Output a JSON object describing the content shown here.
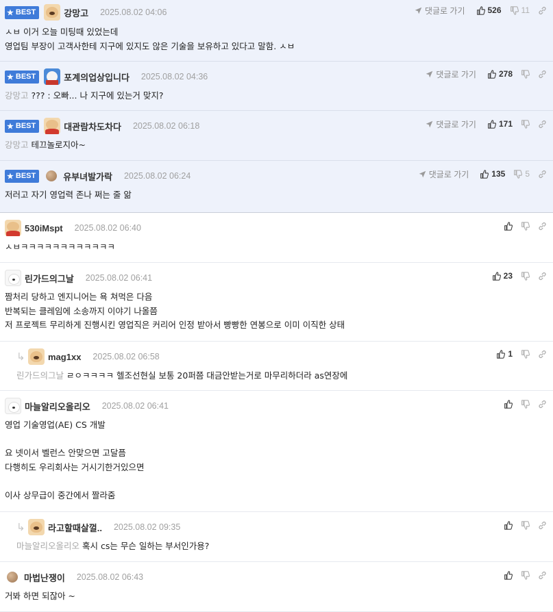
{
  "best_label": "BEST",
  "reply_to_label": "댓글로 가기",
  "comments": [
    {
      "username": "강망고",
      "date": "2025.08.02 04:06",
      "up": "526",
      "down": "11",
      "lines": [
        "ㅅㅂ 이거 오늘 미팅때 있었는데",
        "영업팀 부장이 고객사한테 지구에 있지도 않은 기술을 보유하고 있다고 말함. ㅅㅂ"
      ]
    },
    {
      "username": "포계의업상입니다",
      "date": "2025.08.02 04:36",
      "up": "278",
      "down": "",
      "mention": "강망고",
      "text": "??? : 오빠... 나 지구에 있는거 맞지?"
    },
    {
      "username": "대관람차도차다",
      "date": "2025.08.02 06:18",
      "up": "171",
      "down": "",
      "mention": "강망고",
      "text": "테끄놀로지아~"
    },
    {
      "username": "유부녀발가락",
      "date": "2025.08.02 06:24",
      "up": "135",
      "down": "5",
      "text": "저러고 자기 영업력 존나 쩌는 줄 앎"
    },
    {
      "username": "530iMspt",
      "date": "2025.08.02 06:40",
      "up": "",
      "text": "ㅅㅂㅋㅋㅋㅋㅋㅋㅋㅋㅋㅋㅋㅋ"
    },
    {
      "username": "린가드의그날",
      "date": "2025.08.02 06:41",
      "up": "23",
      "lines": [
        "짬처리 당하고 엔지니어는 욕 쳐먹은 다음",
        "반복되는 클레임에 소송까지 이야기 나올쯤",
        "저 프로젝트 무리하게 진행시킨 영업직은 커리어 인정 받아서 빵빵한 연봉으로 이미 이직한 상태"
      ]
    },
    {
      "username": "mag1xx",
      "date": "2025.08.02 06:58",
      "up": "1",
      "mention": "린가드의그날",
      "text": "ㄹㅇㅋㅋㅋㅋ 헬조선현실 보통 20퍼쯤 대금안받는거로 마무리하더라 as연장에"
    },
    {
      "username": "마늘알리오올리오",
      "date": "2025.08.02 06:41",
      "up": "",
      "lines": [
        "영업 기술영업(AE) CS 개발",
        "",
        "요 넷이서 벨런스 안맞으면 고달픔",
        "다행히도 우리회사는 거시기한거있으면",
        "",
        "이사 상무급이 중간에서 짤라줌"
      ]
    },
    {
      "username": "라고할때살껄..",
      "date": "2025.08.02 09:35",
      "up": "",
      "mention": "마늘알리오올리오",
      "text": "혹시 cs는 무슨 일하는 부서인가용?"
    },
    {
      "username": "마법난쟁이",
      "date": "2025.08.02 06:43",
      "up": "",
      "text": "거봐 하면 되잖아 ~"
    }
  ]
}
